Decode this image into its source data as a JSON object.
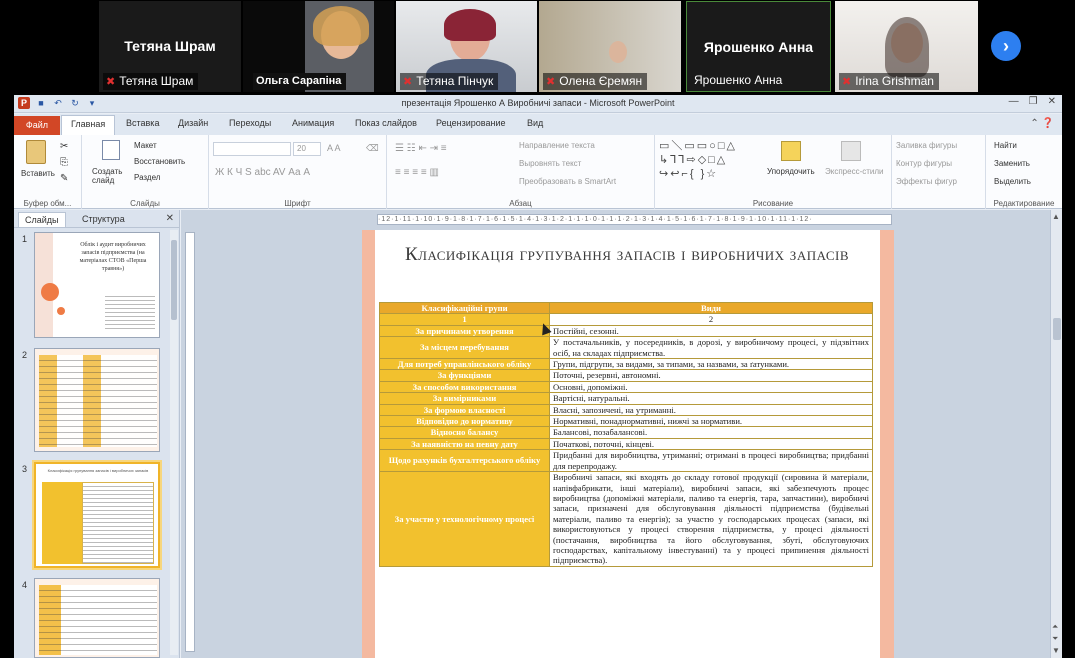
{
  "participants": [
    {
      "id": "tetiana-shram",
      "big_name": "Тетяна Шрам",
      "label": "Тетяна Шрам",
      "muted": true,
      "video": false
    },
    {
      "id": "olha",
      "big_name": "",
      "label": "Ольга Сарапіна",
      "muted": false,
      "video": true
    },
    {
      "id": "tetiana-pinchuk",
      "big_name": "",
      "label": "Тетяна Пінчук",
      "muted": true,
      "video": true
    },
    {
      "id": "olena",
      "big_name": "",
      "label": "Олена Єремян",
      "muted": true,
      "video": true
    },
    {
      "id": "yaroshenko",
      "big_name": "Ярошенко Анна",
      "label": "Ярошенко Анна",
      "muted": false,
      "video": false
    },
    {
      "id": "irina",
      "big_name": "",
      "label": "Irina Grishman",
      "muted": true,
      "video": true
    }
  ],
  "window": {
    "title": "презентація Ярошенко А Виробничі запаси  -  Microsoft PowerPoint"
  },
  "ribbon_tabs": [
    "Файл",
    "Главная",
    "Вставка",
    "Дизайн",
    "Переходы",
    "Анимация",
    "Показ слайдов",
    "Рецензирование",
    "Вид"
  ],
  "ribbon": {
    "clipboard": {
      "paste": "Вставить",
      "label": "Буфер обм..."
    },
    "slides": {
      "new_slide": "Создать слайд",
      "layout": "Макет",
      "reset": "Восстановить",
      "section": "Раздел",
      "label": "Слайды"
    },
    "font": {
      "size": "20",
      "label": "Шрифт",
      "buttons": "Ж  К  Ч  S  abc  AV  Аа  А"
    },
    "paragraph": {
      "direction": "Направление текста",
      "align": "Выровнять текст",
      "smartart": "Преобразовать в SmartArt",
      "label": "Абзац"
    },
    "drawing": {
      "arrange": "Упорядочить",
      "quick_styles": "Экспресс-стили",
      "fill": "Заливка фигуры",
      "outline": "Контур фигуры",
      "effects": "Эффекты фигур",
      "label": "Рисование"
    },
    "editing": {
      "find": "Найти",
      "replace": "Заменить",
      "select": "Выделить",
      "label": "Редактирование"
    }
  },
  "pane": {
    "tabs": [
      "Слайды",
      "Структура"
    ],
    "thumbs": [
      {
        "num": "1",
        "text": "Облік і аудит виробничих запасів підприємства (на матеріалах СТОВ «Перша травня»)"
      },
      {
        "num": "2",
        "text": ""
      },
      {
        "num": "3",
        "text": "Класифікація групування запасів і виробничих запасів"
      },
      {
        "num": "4",
        "text": ""
      }
    ]
  },
  "ruler": "·12·1·11·1·10·1·9·1·8·1·7·1·6·1·5·1·4·1·3·1·2·1·1·1·0·1·1·1·2·1·3·1·4·1·5·1·6·1·7·1·8·1·9·1·10·1·11·1·12·",
  "slide": {
    "title": "Класифікація групування запасів і виробничих запасів",
    "table": {
      "headers": [
        "Класифікаційні групи",
        "Види"
      ],
      "numbers": [
        "1",
        "2"
      ],
      "rows": [
        {
          "group": "За причинами утворення",
          "kinds": "Постійні, сезонні."
        },
        {
          "group": "За місцем перебування",
          "kinds": "У постачальників, у посередників, в дорозі, у виробничому процесі, у підзвітних осіб, на складах підприємства."
        },
        {
          "group": "Для потреб управлінського обліку",
          "kinds": "Групи, підгрупи, за видами, за типами, за назвами, за ґатунками."
        },
        {
          "group": "За функціями",
          "kinds": "Поточні, резервні, автономні."
        },
        {
          "group": "За способом використання",
          "kinds": "Основні, допоміжні."
        },
        {
          "group": "За вимірниками",
          "kinds": "Вартісні, натуральні."
        },
        {
          "group": "За формою власності",
          "kinds": "Власні, запозичені, на утриманні."
        },
        {
          "group": "Відповідно до нормативу",
          "kinds": "Нормативні, понаднормативні, нижчі за нормативи."
        },
        {
          "group": "Відносно балансу",
          "kinds": "Балансові, позабалансові."
        },
        {
          "group": "За наявністю на певну дату",
          "kinds": "Початкові, поточні, кінцеві."
        },
        {
          "group": "Щодо рахунків бухгалтерського обліку",
          "kinds": "Придбанні для виробництва, утриманні; отримані в процесі виробництва; придбанні для перепродажу."
        },
        {
          "group": "За участю у технологічному процесі",
          "kinds": "Виробничі запаси, які входять до складу готової продукції (сировина й матеріали, напівфабрикати, інші матеріали), виробничі запаси, які забезпечують процес виробництва (допоміжні матеріали, паливо та енергія, тара, запчастини), виробничі запаси, призначені для обслуговування діяльності підприємства (будівельні матеріали, паливо та енергія); за участю у господарських процесах (запаси, які використовуються у процесі створення підприємства, у процесі діяльності (постачання, виробництва та його обслуговування, збуті, обслуговуючих господарствах, капітальному інвестуванні) та у процесі припинення діяльності підприємства)."
        }
      ]
    }
  }
}
